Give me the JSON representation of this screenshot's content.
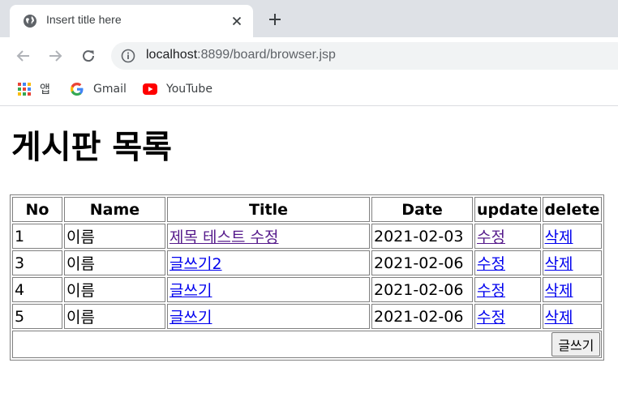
{
  "browser": {
    "tab_title": "Insert title here",
    "url_host": "localhost",
    "url_path": ":8899/board/browser.jsp",
    "bookmarks": [
      {
        "label": "앱",
        "icon": "apps-grid-icon"
      },
      {
        "label": "Gmail",
        "icon": "google-g-icon"
      },
      {
        "label": "YouTube",
        "icon": "youtube-icon"
      }
    ]
  },
  "page": {
    "title": "게시판 목록"
  },
  "board": {
    "headers": {
      "no": "No",
      "name": "Name",
      "title": "Title",
      "date": "Date",
      "update": "update",
      "delete": "delete"
    },
    "rows": [
      {
        "no": "1",
        "name": "이름",
        "title": "제목 테스트 수정",
        "date": "2021-02-03",
        "update": "수정",
        "delete": "삭제"
      },
      {
        "no": "3",
        "name": "이름",
        "title": "글쓰기2",
        "date": "2021-02-06",
        "update": "수정",
        "delete": "삭제"
      },
      {
        "no": "4",
        "name": "이름",
        "title": "글쓰기",
        "date": "2021-02-06",
        "update": "수정",
        "delete": "삭제"
      },
      {
        "no": "5",
        "name": "이름",
        "title": "글쓰기",
        "date": "2021-02-06",
        "update": "수정",
        "delete": "삭제"
      }
    ],
    "write_button": "글쓰기"
  }
}
